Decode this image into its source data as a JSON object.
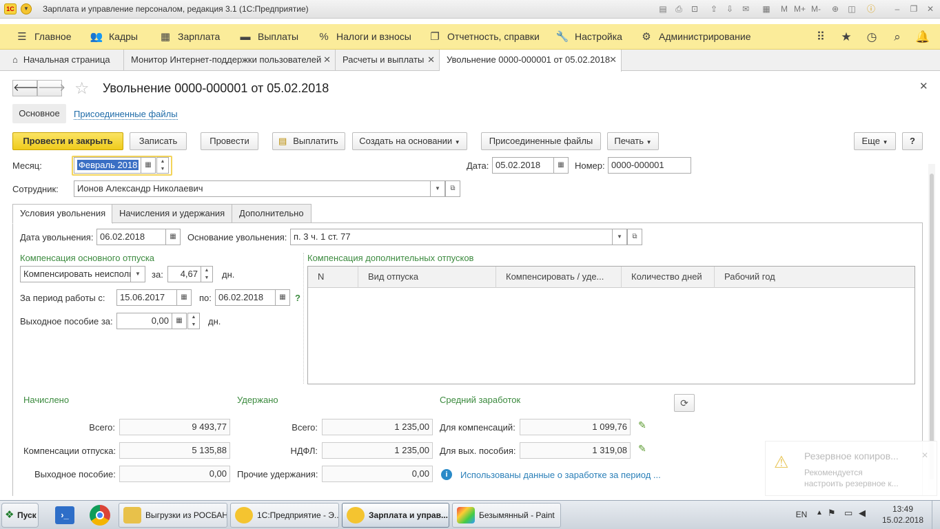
{
  "window": {
    "title": "Зарплата и управление персоналом, редакция 3.1  (1С:Предприятие)"
  },
  "menu": {
    "items": [
      "Главное",
      "Кадры",
      "Зарплата",
      "Выплаты",
      "Налоги и взносы",
      "Отчетность, справки",
      "Настройка",
      "Администрирование"
    ]
  },
  "tabs": {
    "home": "Начальная страница",
    "items": [
      "Монитор Интернет-поддержки пользователей",
      "Расчеты и выплаты",
      "Увольнение 0000-000001 от 05.02.2018"
    ]
  },
  "form": {
    "title": "Увольнение 0000-000001 от 05.02.2018",
    "sections": {
      "main": "Основное",
      "files": "Присоединенные файлы"
    },
    "buttons": {
      "post_close": "Провести и закрыть",
      "save": "Записать",
      "post": "Провести",
      "pay": "Выплатить",
      "create_based": "Создать на основании",
      "files": "Присоединенные файлы",
      "print": "Печать",
      "more": "Еще",
      "help": "?"
    },
    "month": {
      "label": "Месяц:",
      "value": "Февраль 2018"
    },
    "date": {
      "label": "Дата:",
      "value": "05.02.2018"
    },
    "number": {
      "label": "Номер:",
      "value": "0000-000001"
    },
    "employee": {
      "label": "Сотрудник:",
      "value": "Ионов Александр Николаевич"
    },
    "inner_tabs": [
      "Условия увольнения",
      "Начисления и удержания",
      "Дополнительно"
    ],
    "dismissal_date": {
      "label": "Дата увольнения:",
      "value": "06.02.2018"
    },
    "dismissal_basis": {
      "label": "Основание увольнения:",
      "value": "п. 3 ч. 1 ст. 77"
    },
    "main_comp": {
      "title": "Компенсация основного отпуска",
      "mode": "Компенсировать неисполь",
      "for_label": "за:",
      "days": "4,67",
      "days_unit": "дн.",
      "period_label": "За период работы с:",
      "period_from": "15.06.2017",
      "to_label": "по:",
      "period_to": "06.02.2018",
      "q": "?",
      "severance_label": "Выходное пособие за:",
      "severance_days": "0,00",
      "severance_unit": "дн."
    },
    "extra_comp": {
      "title": "Компенсация дополнительных отпусков",
      "columns": [
        "N",
        "Вид отпуска",
        "Компенсировать / уде...",
        "Количество дней",
        "Рабочий год"
      ]
    },
    "accrued": {
      "title": "Начислено",
      "total_label": "Всего:",
      "total": "9 493,77",
      "vacation_label": "Компенсации отпуска:",
      "vacation": "5 135,88",
      "severance_label": "Выходное пособие:",
      "severance": "0,00"
    },
    "withheld": {
      "title": "Удержано",
      "total_label": "Всего:",
      "total": "1 235,00",
      "ndfl_label": "НДФЛ:",
      "ndfl": "1 235,00",
      "other_label": "Прочие удержания:",
      "other": "0,00"
    },
    "avg": {
      "title": "Средний заработок",
      "comp_label": "Для компенсаций:",
      "comp": "1 099,76",
      "sev_label": "Для вых. пособия:",
      "sev": "1 319,08",
      "info": "Использованы данные о заработке за период ..."
    }
  },
  "notification": {
    "title": "Резервное копиров...",
    "text1": "Рекомендуется",
    "text2": "настроить резервное к..."
  },
  "taskbar": {
    "start": "Пуск",
    "items": [
      "Выгрузки из РОСБАНК",
      "1С:Предприятие - Э...",
      "Зарплата и управ...",
      "Безымянный - Paint"
    ],
    "lang": "EN",
    "time": "13:49",
    "date": "15.02.2018"
  },
  "colors": {
    "menu_bg": "#fbec9a",
    "primary_btn": "#f3d02e",
    "section_green": "#3b8a3e",
    "link": "#1e6ba8"
  }
}
